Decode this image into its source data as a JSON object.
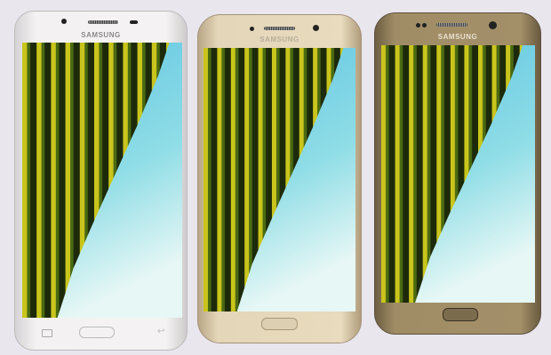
{
  "phones": [
    {
      "brand": "SAMSUNG",
      "color": "white"
    },
    {
      "brand": "SAMSUNG",
      "color": "gold"
    },
    {
      "brand": "SAMSUNG",
      "color": "dark-gold"
    }
  ],
  "colors": {
    "sky_top": "#5ec4e2",
    "sky_bottom": "#e6f7f5",
    "stripe_light": "#c9c51c",
    "stripe_dark": "#1d2a0a"
  }
}
